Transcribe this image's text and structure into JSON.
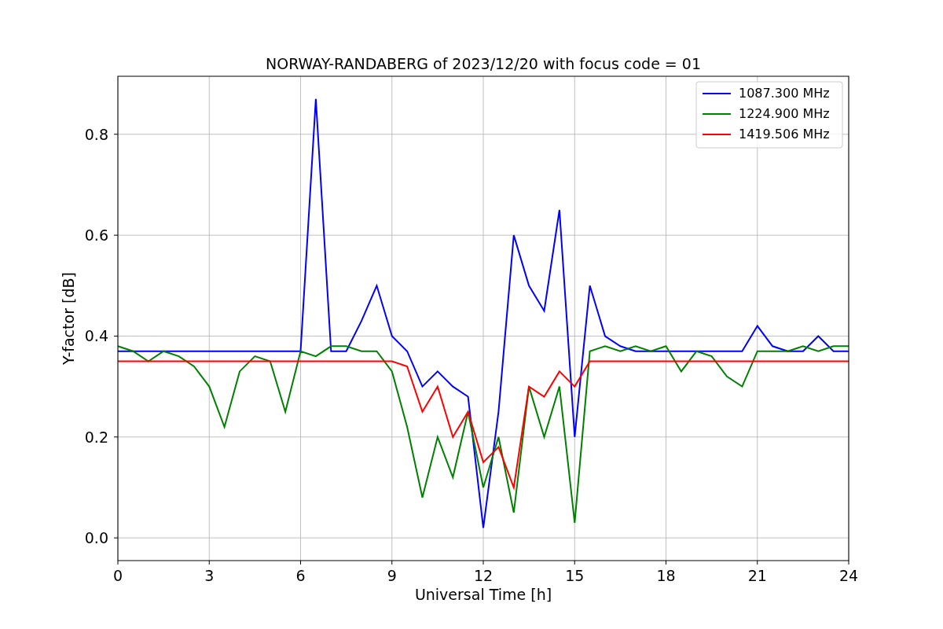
{
  "chart_data": {
    "type": "line",
    "title": "NORWAY-RANDABERG of 2023/12/20 with focus code = 01",
    "xlabel": "Universal Time [h]",
    "ylabel": "Y-factor [dB]",
    "x": [
      0,
      0.5,
      1,
      1.5,
      2,
      2.5,
      3,
      3.5,
      4,
      4.5,
      5,
      5.5,
      6,
      6.5,
      7,
      7.5,
      8,
      8.5,
      9,
      9.5,
      10,
      10.5,
      11,
      11.5,
      12,
      12.5,
      13,
      13.5,
      14,
      14.5,
      15,
      15.5,
      16,
      16.5,
      17,
      17.5,
      18,
      18.5,
      19,
      19.5,
      20,
      20.5,
      21,
      21.5,
      22,
      22.5,
      23,
      23.5,
      24
    ],
    "series": [
      {
        "name": "1087.300 MHz",
        "color": "#0000ff",
        "values": [
          0.37,
          0.37,
          0.37,
          0.37,
          0.37,
          0.37,
          0.37,
          0.37,
          0.37,
          0.37,
          0.37,
          0.37,
          0.37,
          0.87,
          0.37,
          0.37,
          0.43,
          0.5,
          0.4,
          0.37,
          0.3,
          0.33,
          0.3,
          0.28,
          0.02,
          0.25,
          0.6,
          0.5,
          0.45,
          0.65,
          0.2,
          0.5,
          0.4,
          0.38,
          0.37,
          0.37,
          0.37,
          0.37,
          0.37,
          0.37,
          0.37,
          0.37,
          0.42,
          0.38,
          0.37,
          0.37,
          0.4,
          0.37,
          0.37
        ]
      },
      {
        "name": "1224.900 MHz",
        "color": "#008000",
        "values": [
          0.38,
          0.37,
          0.35,
          0.37,
          0.36,
          0.34,
          0.3,
          0.22,
          0.33,
          0.36,
          0.35,
          0.25,
          0.37,
          0.36,
          0.38,
          0.38,
          0.37,
          0.37,
          0.33,
          0.22,
          0.08,
          0.2,
          0.12,
          0.25,
          0.1,
          0.2,
          0.05,
          0.3,
          0.2,
          0.3,
          0.03,
          0.37,
          0.38,
          0.37,
          0.38,
          0.37,
          0.38,
          0.33,
          0.37,
          0.36,
          0.32,
          0.3,
          0.37,
          0.37,
          0.37,
          0.38,
          0.37,
          0.38,
          0.38
        ]
      },
      {
        "name": "1419.506 MHz",
        "color": "#ff0000",
        "values": [
          0.35,
          0.35,
          0.35,
          0.35,
          0.35,
          0.35,
          0.35,
          0.35,
          0.35,
          0.35,
          0.35,
          0.35,
          0.35,
          0.35,
          0.35,
          0.35,
          0.35,
          0.35,
          0.35,
          0.34,
          0.25,
          0.3,
          0.2,
          0.25,
          0.15,
          0.18,
          0.1,
          0.3,
          0.28,
          0.33,
          0.3,
          0.35,
          0.35,
          0.35,
          0.35,
          0.35,
          0.35,
          0.35,
          0.35,
          0.35,
          0.35,
          0.35,
          0.35,
          0.35,
          0.35,
          0.35,
          0.35,
          0.35,
          0.35
        ]
      }
    ],
    "grid": true,
    "legend": true,
    "xlim": [
      0,
      24
    ],
    "ylim": [
      -0.045,
      0.915
    ],
    "xticks": [
      0,
      3,
      6,
      9,
      12,
      15,
      18,
      21,
      24
    ],
    "yticks": [
      {
        "value": 0,
        "label": "0.0"
      },
      {
        "value": 0.2,
        "label": "0.2"
      },
      {
        "value": 0.4,
        "label": "0.4"
      },
      {
        "value": 0.6,
        "label": "0.6"
      },
      {
        "value": 0.8,
        "label": "0.8"
      }
    ]
  }
}
